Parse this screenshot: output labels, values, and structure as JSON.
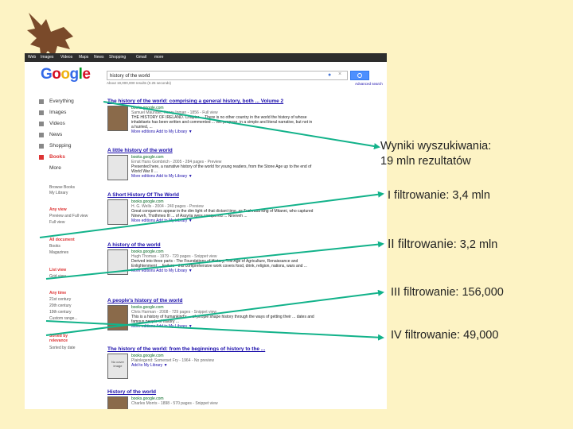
{
  "browser": {
    "nav": [
      "Web",
      "Images",
      "Videos",
      "Maps",
      "News",
      "Shopping",
      "Gmail",
      "more"
    ]
  },
  "google": {
    "logo": "Google",
    "query": "history of the world",
    "stats": "About 19,000,000 results (0.25 seconds)",
    "advanced": "Advanced search"
  },
  "sidebar": {
    "types": [
      "Everything",
      "Images",
      "Videos",
      "News",
      "Shopping",
      "Books",
      "More"
    ],
    "active": "Books",
    "browse": [
      "Browse Books",
      "My Library"
    ],
    "any_view": "Any view",
    "views": [
      "Preview and Full view",
      "Full view"
    ],
    "all_docs": "All document",
    "docs": [
      "Books",
      "Magazines"
    ],
    "list_view": "List view",
    "grid": "Grid view",
    "any_time": "Any time",
    "times": [
      "21st century",
      "20th century",
      "19th century",
      "Custom range..."
    ],
    "sorted": "Sorted by relevance",
    "sort_date": "Sorted by date"
  },
  "results": [
    {
      "title": "The history of the world: comprising a general history, both ... Volume 2",
      "url": "books.google.com",
      "meta": "Samuel Maunder, Henry Inman - 1856 - Full view",
      "snippet": "THE HISTORY OF IRELAND. Chapter ... There is no other country in the world the history of whose inhabitants has been written and commented ... We propose, in a simple and literal narrative, but not in a hurried, ...",
      "more": "More editions  Add to My Library ▼"
    },
    {
      "title": "A little history of the world",
      "url": "books.google.com",
      "meta": "Ernst Hans Gombrich - 2005 - 284 pages - Preview",
      "snippet": "Presented here, a narrative history of the world for young readers, from the Stone Age up to the end of World War II ...",
      "more": "More editions  Add to My Library ▼"
    },
    {
      "title": "A Short History Of The World",
      "url": "books.google.com",
      "meta": "H. G. Wells - 2004 - 240 pages - Preview",
      "snippet": "Great conquerors appear in the dim light of that distant time, as Tushratta king of Mitanni, who captured Nineveh, Thothmes III ... of Assyria were conquered ... Nineveh ...",
      "more": "More editions  Add to My Library ▼"
    },
    {
      "title": "A history of the world",
      "url": "books.google.com",
      "meta": "Hugh Thomas - 1979 - 720 pages - Snippet view",
      "snippet": "Derived into three parts - The Foundations of History, The Age of Agriculture, Renaissance and Enlightenment ... Failure - this comprehensive work covers food, drink, religion, nations, wars and ...",
      "more": "More editions  Add to My Library ▼"
    },
    {
      "title": "A people's history of the world",
      "url": "books.google.com",
      "meta": "Chris Harman - 2008 - 729 pages - Snippet view",
      "snippet": "This is a history of humankind's ... of people shape history through the ways of getting their ... dates and famous people of history ...",
      "more": "More editions  Add to My Library ▼"
    },
    {
      "title": "The history of the world: from the beginnings of history to the ...",
      "url": "books.google.com",
      "meta": "Plainlegend: Somerset Fry - 1964 - No preview",
      "more": "Add to My Library ▼",
      "thumb": "No cover image"
    },
    {
      "title": "History of the world",
      "url": "books.google.com",
      "meta": "Charles Morris - 1898 - 570 pages - Snippet view"
    }
  ],
  "annotations": [
    "Wyniki wyszukiwania:",
    "19 mln rezultatów",
    "I filtrowanie: 3,4 mln",
    "II filtrowanie",
    ": 3,2 mln",
    "III filtrowanie: 156,000",
    "IV filtrowanie: 49,000"
  ],
  "colors": {
    "background": "#fdf3c4",
    "arrow": "#12b28a",
    "link": "#1a0dab",
    "url": "#006621",
    "accent_red": "#d33333"
  }
}
